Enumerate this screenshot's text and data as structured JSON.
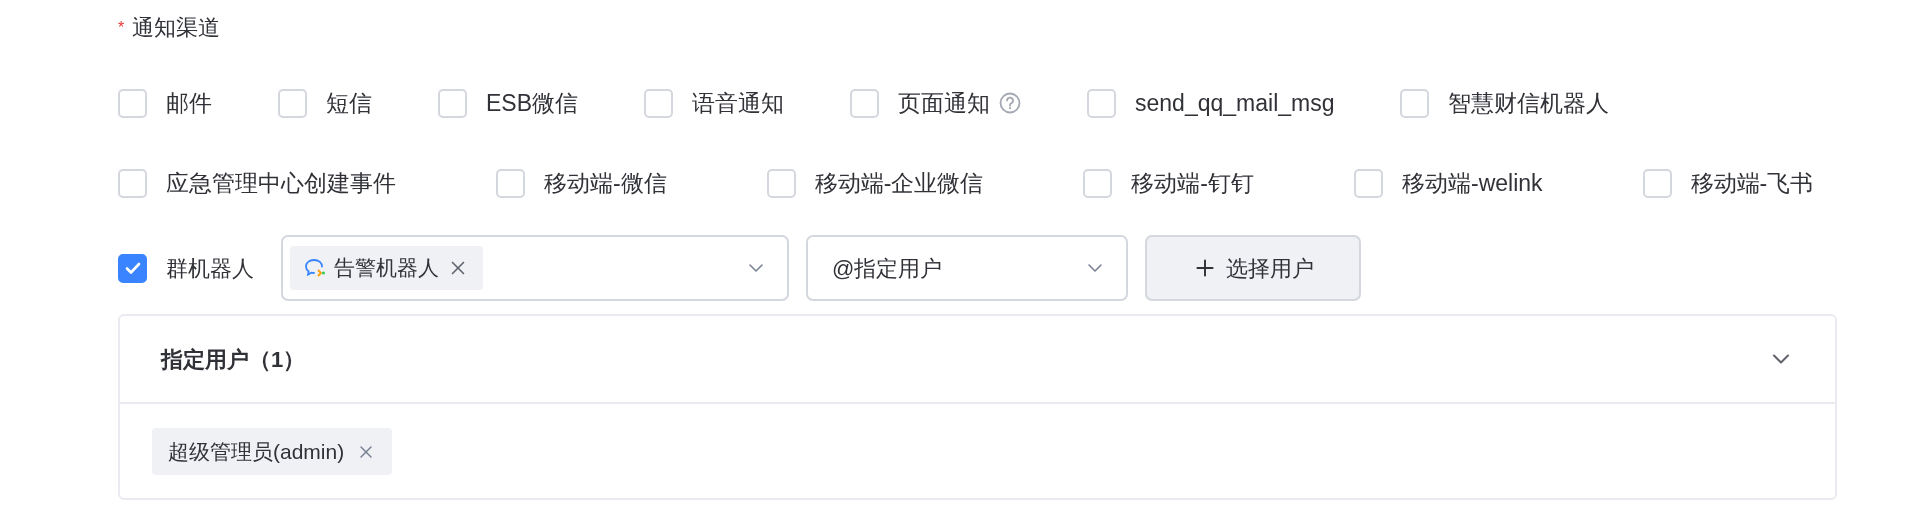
{
  "field": {
    "label": "通知渠道",
    "required_mark": "*"
  },
  "channel_rows": [
    {
      "items": [
        {
          "label": "邮件",
          "checked": false
        },
        {
          "label": "短信",
          "checked": false
        },
        {
          "label": "ESB微信",
          "checked": false
        },
        {
          "label": "语音通知",
          "checked": false
        },
        {
          "label": "页面通知",
          "checked": false,
          "help": true
        },
        {
          "label": "send_qq_mail_msg",
          "checked": false
        },
        {
          "label": "智慧财信机器人",
          "checked": false
        }
      ]
    },
    {
      "items": [
        {
          "label": "应急管理中心创建事件",
          "checked": false
        },
        {
          "label": "移动端-微信",
          "checked": false
        },
        {
          "label": "移动端-企业微信",
          "checked": false
        },
        {
          "label": "移动端-钉钉",
          "checked": false
        },
        {
          "label": "移动端-welink",
          "checked": false
        },
        {
          "label": "移动端-飞书",
          "checked": false
        }
      ]
    }
  ],
  "robot": {
    "label": "群机器人",
    "checked": true,
    "robot_tags": [
      {
        "label": "告警机器人"
      }
    ],
    "mention_value": "@指定用户",
    "select_button": "选择用户"
  },
  "users_panel": {
    "title": "指定用户（1）",
    "expanded": true,
    "users": [
      {
        "label": "超级管理员(admin)"
      }
    ]
  }
}
